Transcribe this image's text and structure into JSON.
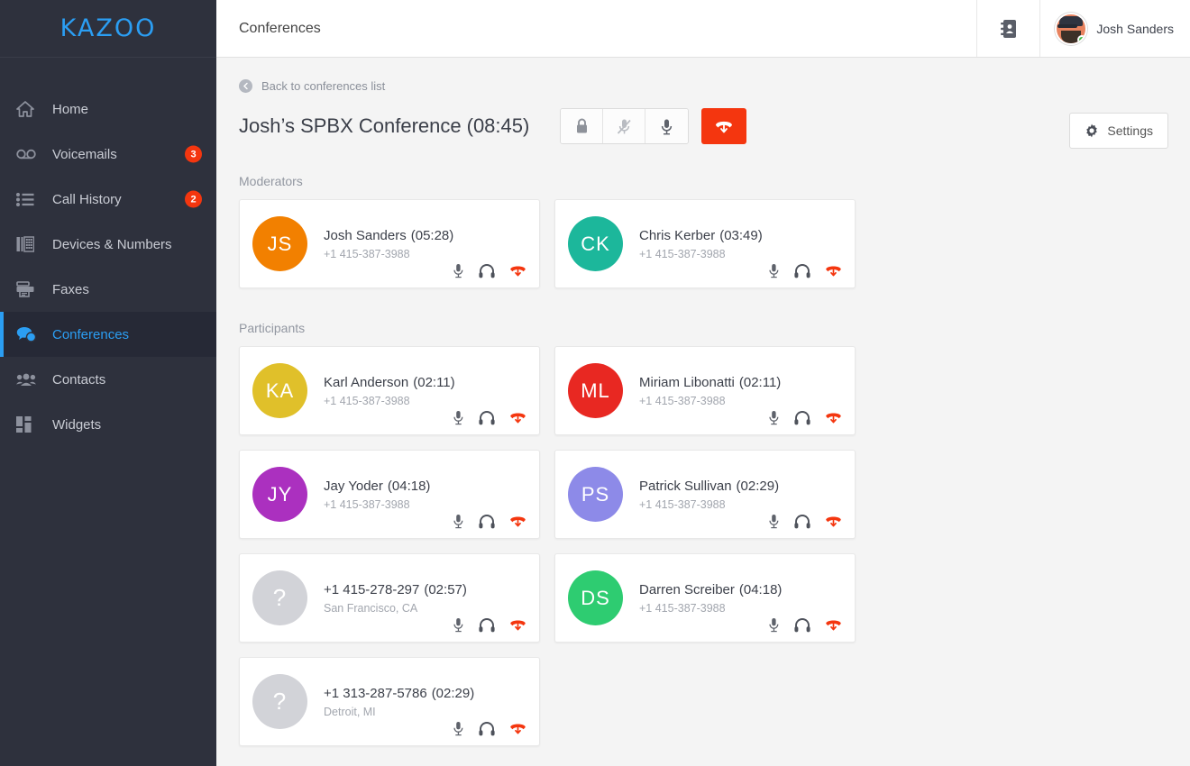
{
  "brand": {
    "logo_text": "KAZOO",
    "accent": "#2b9ef3"
  },
  "sidebar": {
    "items": [
      {
        "label": "Home",
        "icon": "home-icon",
        "badge": null,
        "active": false
      },
      {
        "label": "Voicemails",
        "icon": "voicemail-icon",
        "badge": "3",
        "active": false
      },
      {
        "label": "Call History",
        "icon": "list-icon",
        "badge": "2",
        "active": false
      },
      {
        "label": "Devices & Numbers",
        "icon": "devices-icon",
        "badge": null,
        "active": false
      },
      {
        "label": "Faxes",
        "icon": "fax-icon",
        "badge": null,
        "active": false
      },
      {
        "label": "Conferences",
        "icon": "chat-bubbles-icon",
        "badge": null,
        "active": true
      },
      {
        "label": "Contacts",
        "icon": "people-icon",
        "badge": null,
        "active": false
      },
      {
        "label": "Widgets",
        "icon": "widgets-icon",
        "badge": null,
        "active": false
      }
    ]
  },
  "topbar": {
    "title": "Conferences",
    "addressbook_icon": "address-book-icon",
    "user_name": "Josh Sanders",
    "status": "online",
    "status_color": "#3fc04a"
  },
  "content": {
    "back_link": "Back to conferences list",
    "conference_title": "Josh’s SPBX Conference",
    "conference_duration": "(08:45)",
    "toolbar": [
      {
        "name": "lock-conference-button",
        "icon": "lock-icon"
      },
      {
        "name": "mute-all-button",
        "icon": "mic-muted-icon"
      },
      {
        "name": "unmute-all-button",
        "icon": "mic-icon"
      }
    ],
    "hangup_button": {
      "name": "end-conference-button",
      "icon": "hangup-icon",
      "color": "#f4360f"
    },
    "settings_label": "Settings",
    "settings_icon": "gear-icon",
    "moderators_label": "Moderators",
    "participants_label": "Participants",
    "action_icons": {
      "mic": "mic-icon",
      "headset": "headphones-icon",
      "hangup": "hangup-icon"
    }
  },
  "moderators": [
    {
      "initials": "JS",
      "color": "#f28000",
      "name": "Josh Sanders",
      "duration": "(05:28)",
      "sub": "+1 415-387-3988"
    },
    {
      "initials": "CK",
      "color": "#1cb79b",
      "name": "Chris Kerber",
      "duration": "(03:49)",
      "sub": "+1 415-387-3988"
    }
  ],
  "participants": [
    {
      "initials": "KA",
      "color": "#e0c02a",
      "name": "Karl Anderson",
      "duration": "(02:11)",
      "sub": "+1 415-387-3988"
    },
    {
      "initials": "ML",
      "color": "#e82822",
      "name": "Miriam Libonatti",
      "duration": "(02:11)",
      "sub": "+1 415-387-3988"
    },
    {
      "initials": "JY",
      "color": "#ab30bf",
      "name": "Jay Yoder",
      "duration": "(04:18)",
      "sub": "+1 415-387-3988"
    },
    {
      "initials": "PS",
      "color": "#8d8ae8",
      "name": "Patrick Sullivan",
      "duration": "(02:29)",
      "sub": "+1 415-387-3988"
    },
    {
      "initials": "?",
      "color": "#d2d3d8",
      "name": "+1 415-278-297",
      "duration": "(02:57)",
      "sub": "San Francisco, CA"
    },
    {
      "initials": "DS",
      "color": "#2ecc71",
      "name": "Darren Screiber",
      "duration": "(04:18)",
      "sub": "+1 415-387-3988"
    },
    {
      "initials": "?",
      "color": "#d2d3d8",
      "name": "+1 313-287-5786",
      "duration": "(02:29)",
      "sub": "Detroit, MI"
    }
  ]
}
